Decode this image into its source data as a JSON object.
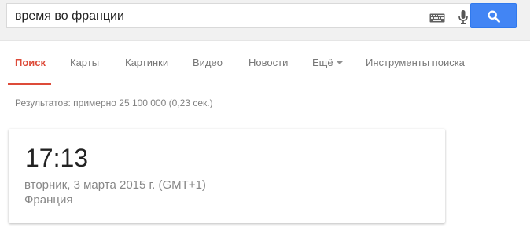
{
  "search": {
    "query": "время во франции"
  },
  "nav": {
    "tabs": [
      {
        "label": "Поиск"
      },
      {
        "label": "Карты"
      },
      {
        "label": "Картинки"
      },
      {
        "label": "Видео"
      },
      {
        "label": "Новости"
      },
      {
        "label": "Ещё"
      },
      {
        "label": "Инструменты поиска"
      }
    ]
  },
  "results": {
    "stats": "Результатов: примерно 25 100 000 (0,23 сек.)"
  },
  "time_card": {
    "time": "17:13",
    "date": "вторник, 3 марта 2015 г. (GMT+1)",
    "location": "Франция"
  },
  "colors": {
    "accent": "#dd4b39",
    "search_button": "#4285f4"
  },
  "icons": {
    "keyboard": "keyboard-icon",
    "mic": "microphone-icon",
    "search": "magnifier-icon",
    "more": "caret-down-icon"
  }
}
